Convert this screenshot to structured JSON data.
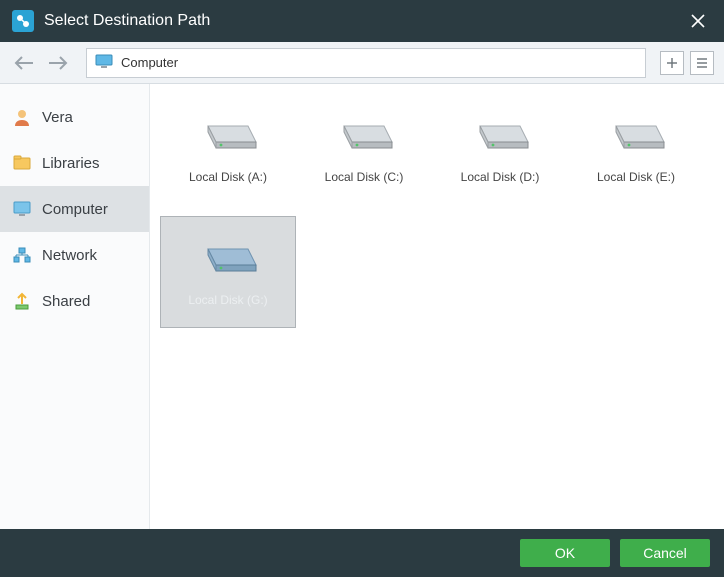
{
  "titlebar": {
    "title": "Select Destination Path"
  },
  "nav": {
    "location": "Computer"
  },
  "sidebar": {
    "items": [
      {
        "label": "Vera"
      },
      {
        "label": "Libraries"
      },
      {
        "label": "Computer"
      },
      {
        "label": "Network"
      },
      {
        "label": "Shared"
      }
    ]
  },
  "disks": [
    {
      "label": "Local Disk (A:)",
      "selected": false
    },
    {
      "label": "Local Disk (C:)",
      "selected": false
    },
    {
      "label": "Local Disk (D:)",
      "selected": false
    },
    {
      "label": "Local Disk (E:)",
      "selected": false
    },
    {
      "label": "Local Disk (G:)",
      "selected": true
    }
  ],
  "footer": {
    "ok": "OK",
    "cancel": "Cancel"
  }
}
